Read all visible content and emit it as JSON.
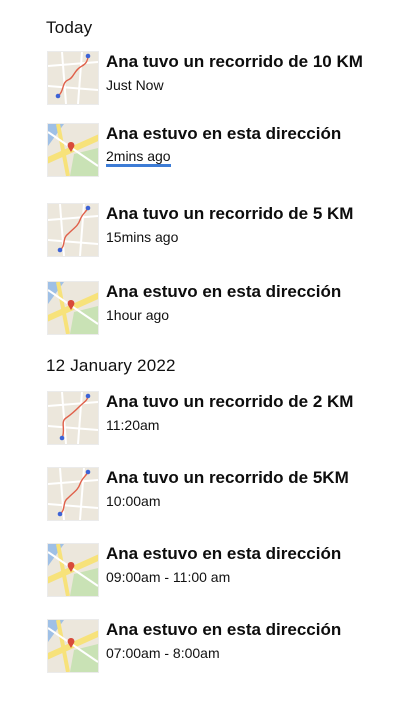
{
  "sections": [
    {
      "title": "Today",
      "items": [
        {
          "type": "route",
          "title": "Ana tuvo un recorrido de 10 KM",
          "sub": "Just Now"
        },
        {
          "type": "location",
          "title": "Ana estuvo en esta dirección",
          "sub": "2mins ago"
        },
        {
          "type": "route",
          "title": "Ana tuvo un recorrido de 5 KM",
          "sub": "15mins ago"
        },
        {
          "type": "location",
          "title": "Ana estuvo en esta dirección",
          "sub": "1hour ago"
        }
      ]
    },
    {
      "title": "12 January 2022",
      "items": [
        {
          "type": "route",
          "title": "Ana tuvo un recorrido de 2 KM",
          "sub": "11:20am"
        },
        {
          "type": "route",
          "title": "Ana tuvo un recorrido de 5KM",
          "sub": "10:00am"
        },
        {
          "type": "location",
          "title": "Ana estuvo en esta dirección",
          "sub": "09:00am - 11:00 am"
        },
        {
          "type": "location",
          "title": "Ana estuvo en esta dirección",
          "sub": "07:00am - 8:00am"
        }
      ]
    }
  ],
  "colors": {
    "route_line": "#e0604a",
    "pin": "#3d63d6",
    "loc_pin": "#d84a3a",
    "map_bg": "#ece7dc",
    "park": "#c9e2b5",
    "road": "#f7e27a",
    "water": "#9fc0e6",
    "underline": "#3d7cd6"
  }
}
